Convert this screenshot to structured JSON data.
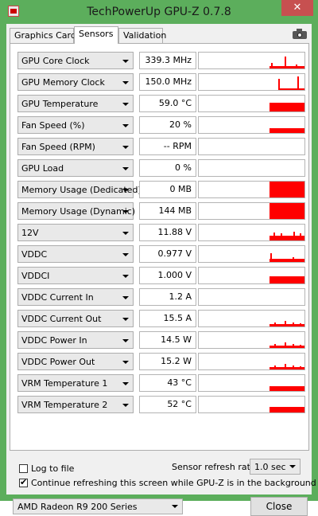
{
  "window": {
    "title": "TechPowerUp GPU-Z 0.7.8",
    "close_glyph": "✕"
  },
  "tabs": [
    {
      "label": "Graphics Card"
    },
    {
      "label": "Sensors"
    },
    {
      "label": "Validation"
    }
  ],
  "icons": {
    "camera": "camera-icon",
    "app": "gpuz-app-icon",
    "dropdown": "chevron-down-icon"
  },
  "colors": {
    "graph_fill": "#ff0000",
    "titlebar": "#5cae5c"
  },
  "sensors": [
    {
      "label": "GPU Core Clock",
      "value": "339.3 MHz",
      "graph": "spike"
    },
    {
      "label": "GPU Memory Clock",
      "value": "150.0 MHz",
      "graph": "spike2"
    },
    {
      "label": "GPU Temperature",
      "value": "59.0 °C",
      "graph": "block-mid"
    },
    {
      "label": "Fan Speed (%)",
      "value": "20 %",
      "graph": "block-low"
    },
    {
      "label": "Fan Speed (RPM)",
      "value": "-- RPM",
      "graph": "none"
    },
    {
      "label": "GPU Load",
      "value": "0 %",
      "graph": "none"
    },
    {
      "label": "Memory Usage (Dedicated)",
      "value": "0 MB",
      "graph": "full"
    },
    {
      "label": "Memory Usage (Dynamic)",
      "value": "144 MB",
      "graph": "full"
    },
    {
      "label": "12V",
      "value": "11.88 V",
      "graph": "noisy-mid"
    },
    {
      "label": "VDDC",
      "value": "0.977 V",
      "graph": "vddc"
    },
    {
      "label": "VDDCI",
      "value": "1.000 V",
      "graph": "block-half"
    },
    {
      "label": "VDDC Current In",
      "value": "1.2 A",
      "graph": "none"
    },
    {
      "label": "VDDC Current Out",
      "value": "15.5 A",
      "graph": "noisy-low"
    },
    {
      "label": "VDDC Power In",
      "value": "14.5 W",
      "graph": "noisy-low"
    },
    {
      "label": "VDDC Power Out",
      "value": "15.2 W",
      "graph": "noisy-low"
    },
    {
      "label": "VRM Temperature 1",
      "value": "43 °C",
      "graph": "block-low"
    },
    {
      "label": "VRM Temperature 2",
      "value": "52 °C",
      "graph": "block-low2"
    }
  ],
  "footer": {
    "log_label": "Log to file",
    "log_checked": false,
    "refresh_label": "Sensor refresh rate:",
    "refresh_value": "1.0 sec",
    "continue_label": "Continue refreshing this screen while GPU-Z is in the background",
    "continue_checked": true,
    "gpu_select": "AMD Radeon R9 200 Series",
    "close_label": "Close"
  }
}
